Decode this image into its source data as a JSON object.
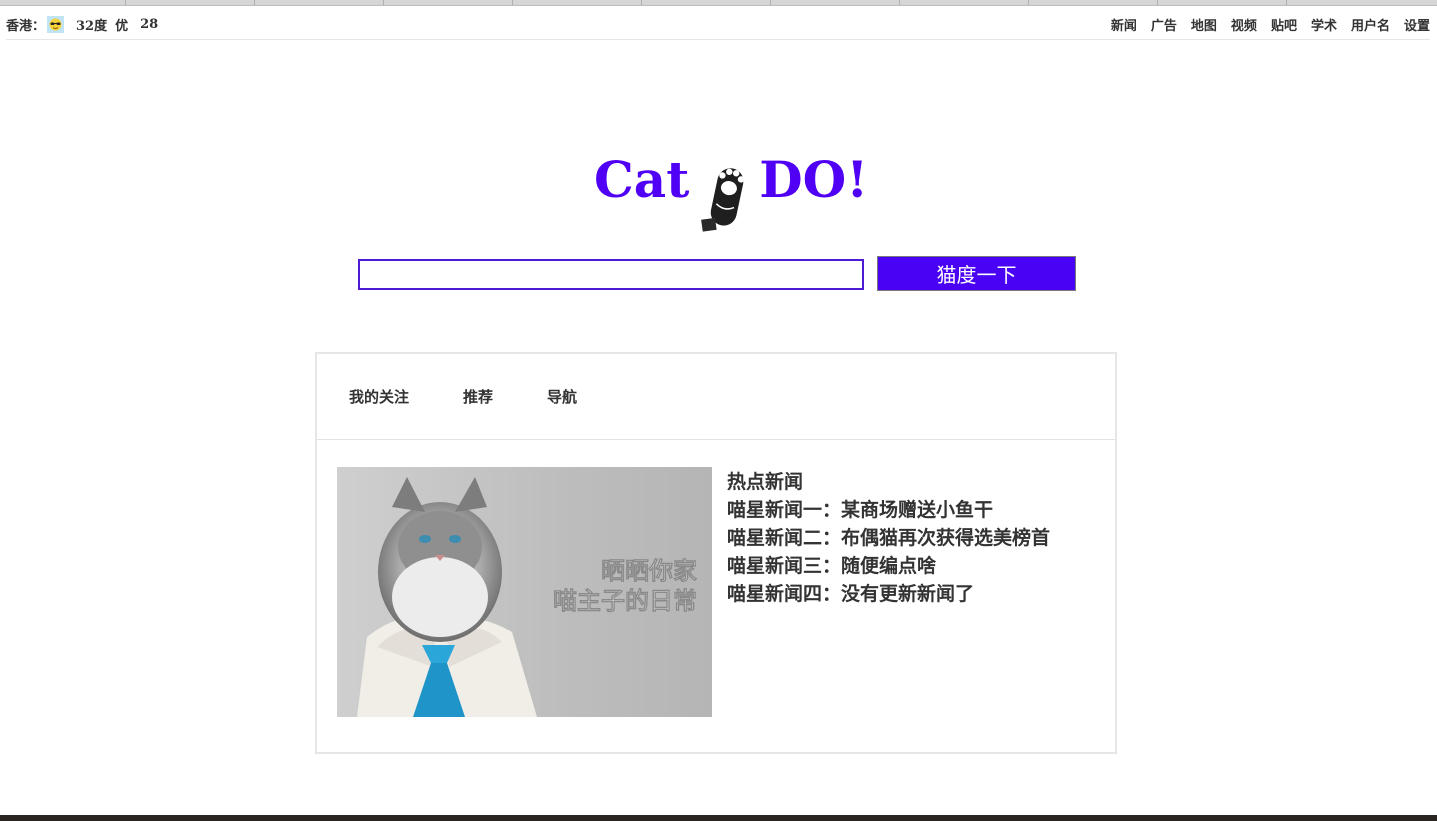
{
  "topbar": {
    "city": "香港：",
    "weather_icon": "sunny-sunglasses-icon",
    "temperature": "32度",
    "air_quality": "优",
    "aqi": "28",
    "links": [
      "新闻",
      "广告",
      "地图",
      "视频",
      "贴吧",
      "学术",
      "用户名",
      "设置"
    ]
  },
  "logo": {
    "left": "Cat",
    "right": "DO!",
    "icon": "cat-paw-icon",
    "color": "#4f00f5"
  },
  "search": {
    "value": "",
    "button_label": "猫度一下",
    "button_color": "#4a02f5"
  },
  "tabs": [
    "我的关注",
    "推荐",
    "导航"
  ],
  "news": {
    "image_caption_line1": "晒晒你家",
    "image_caption_line2": "喵主子的日常",
    "heading": "热点新闻",
    "items": [
      "喵星新闻一：某商场赠送小鱼干",
      "喵星新闻二：布偶猫再次获得选美榜首",
      "喵星新闻三：随便编点啥",
      "喵星新闻四：没有更新新闻了"
    ]
  }
}
